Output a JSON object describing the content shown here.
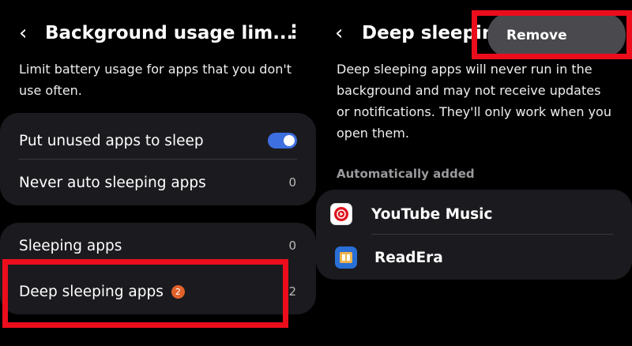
{
  "left": {
    "title": "Background usage lim...",
    "description_line1": "Limit battery usage for apps that you don't",
    "description_line2": "use often.",
    "card1": {
      "row1_label": "Put unused apps to sleep",
      "row1_toggle": "on",
      "row2_label": "Never auto sleeping apps",
      "row2_value": "0"
    },
    "card2": {
      "row1_label": "Sleeping apps",
      "row1_value": "0",
      "row2_label": "Deep sleeping apps",
      "row2_badge": "2",
      "row2_value": "2"
    }
  },
  "right": {
    "title": "Deep sleepin",
    "description_lines": [
      "Deep sleeping apps will never run in the",
      "background and may not receive updates",
      "or notifications. They'll only work when you",
      "open them."
    ],
    "section_label": "Automatically added",
    "apps": [
      {
        "name": "YouTube Music",
        "icon": "youtube-music-icon"
      },
      {
        "name": "ReadEra",
        "icon": "readera-icon"
      }
    ],
    "remove_label": "Remove"
  },
  "colors": {
    "highlight": "#ec0d1c",
    "toggle_on": "#3d6fe0",
    "badge": "#e0622a"
  }
}
